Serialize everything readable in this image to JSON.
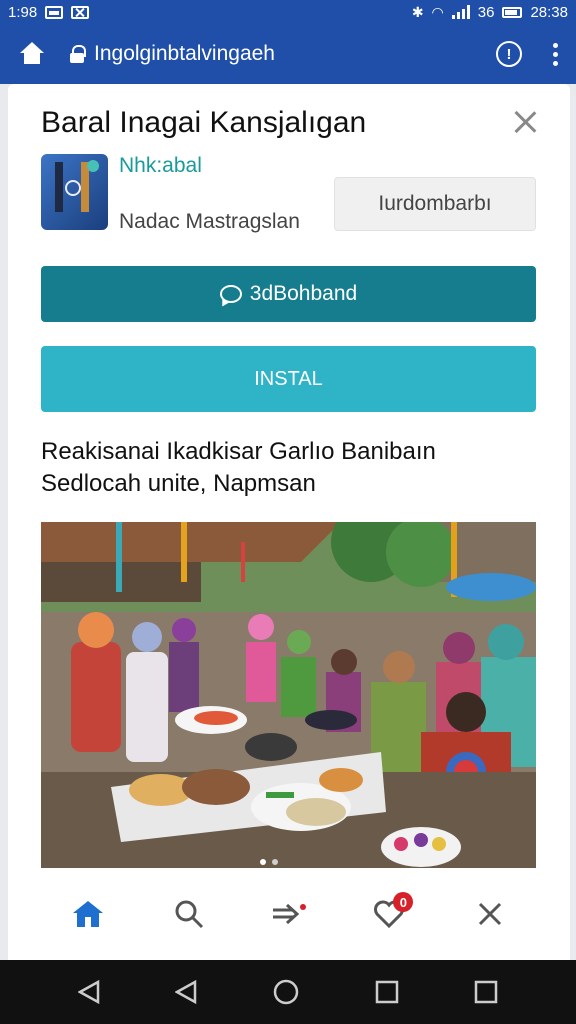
{
  "status_bar": {
    "time_left": "1:98",
    "network": "36",
    "time_right": "28:38"
  },
  "url_bar": {
    "url": "Ingolginbtalvingaeh"
  },
  "dialog": {
    "title": "Baral Inagai Kansjalıgan",
    "app_name": "Nhk:abal",
    "app_developer": "Nadac Mastragslan",
    "open_button": "Iurdombarbı",
    "primary_button": "3dBohband",
    "install_button": "INSTAL",
    "description": "Reakisanai Ikadkisar Garlıo Banibaın Sedlocah unite, Napmsan"
  },
  "bottom_nav": {
    "items": [
      {
        "name": "home",
        "icon": "home-icon",
        "active": true
      },
      {
        "name": "search",
        "icon": "search-icon"
      },
      {
        "name": "share",
        "icon": "share-arrow-icon"
      },
      {
        "name": "favorites",
        "icon": "heart-icon",
        "badge": "0"
      },
      {
        "name": "close",
        "icon": "close-icon"
      }
    ]
  },
  "colors": {
    "header": "#1f4fa8",
    "primary_button": "#157d8e",
    "install_button": "#2fb3c6",
    "accent": "#1a9a9a",
    "badge": "#d6202a",
    "active_nav": "#1e6fd0"
  }
}
